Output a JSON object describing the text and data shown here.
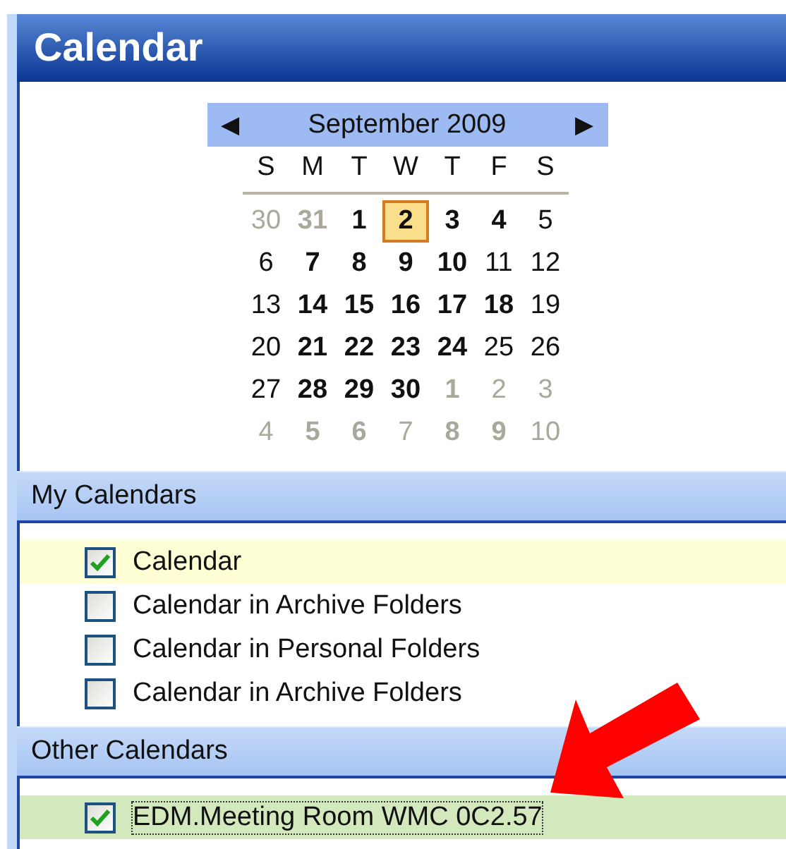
{
  "title": "Calendar",
  "month": {
    "prev": "◀",
    "label": "September 2009",
    "next": "▶",
    "weekdays": [
      "S",
      "M",
      "T",
      "W",
      "T",
      "F",
      "S"
    ],
    "weeks": [
      [
        {
          "day": "30",
          "bold": false,
          "other": true,
          "selected": false
        },
        {
          "day": "31",
          "bold": true,
          "other": true,
          "selected": false
        },
        {
          "day": "1",
          "bold": true,
          "other": false,
          "selected": false
        },
        {
          "day": "2",
          "bold": true,
          "other": false,
          "selected": true
        },
        {
          "day": "3",
          "bold": true,
          "other": false,
          "selected": false
        },
        {
          "day": "4",
          "bold": true,
          "other": false,
          "selected": false
        },
        {
          "day": "5",
          "bold": false,
          "other": false,
          "selected": false
        }
      ],
      [
        {
          "day": "6",
          "bold": false,
          "other": false,
          "selected": false
        },
        {
          "day": "7",
          "bold": true,
          "other": false,
          "selected": false
        },
        {
          "day": "8",
          "bold": true,
          "other": false,
          "selected": false
        },
        {
          "day": "9",
          "bold": true,
          "other": false,
          "selected": false
        },
        {
          "day": "10",
          "bold": true,
          "other": false,
          "selected": false
        },
        {
          "day": "11",
          "bold": false,
          "other": false,
          "selected": false
        },
        {
          "day": "12",
          "bold": false,
          "other": false,
          "selected": false
        }
      ],
      [
        {
          "day": "13",
          "bold": false,
          "other": false,
          "selected": false
        },
        {
          "day": "14",
          "bold": true,
          "other": false,
          "selected": false
        },
        {
          "day": "15",
          "bold": true,
          "other": false,
          "selected": false
        },
        {
          "day": "16",
          "bold": true,
          "other": false,
          "selected": false
        },
        {
          "day": "17",
          "bold": true,
          "other": false,
          "selected": false
        },
        {
          "day": "18",
          "bold": true,
          "other": false,
          "selected": false
        },
        {
          "day": "19",
          "bold": false,
          "other": false,
          "selected": false
        }
      ],
      [
        {
          "day": "20",
          "bold": false,
          "other": false,
          "selected": false
        },
        {
          "day": "21",
          "bold": true,
          "other": false,
          "selected": false
        },
        {
          "day": "22",
          "bold": true,
          "other": false,
          "selected": false
        },
        {
          "day": "23",
          "bold": true,
          "other": false,
          "selected": false
        },
        {
          "day": "24",
          "bold": true,
          "other": false,
          "selected": false
        },
        {
          "day": "25",
          "bold": false,
          "other": false,
          "selected": false
        },
        {
          "day": "26",
          "bold": false,
          "other": false,
          "selected": false
        }
      ],
      [
        {
          "day": "27",
          "bold": false,
          "other": false,
          "selected": false
        },
        {
          "day": "28",
          "bold": true,
          "other": false,
          "selected": false
        },
        {
          "day": "29",
          "bold": true,
          "other": false,
          "selected": false
        },
        {
          "day": "30",
          "bold": true,
          "other": false,
          "selected": false
        },
        {
          "day": "1",
          "bold": true,
          "other": true,
          "selected": false
        },
        {
          "day": "2",
          "bold": false,
          "other": true,
          "selected": false
        },
        {
          "day": "3",
          "bold": false,
          "other": true,
          "selected": false
        }
      ],
      [
        {
          "day": "4",
          "bold": false,
          "other": true,
          "selected": false
        },
        {
          "day": "5",
          "bold": true,
          "other": true,
          "selected": false
        },
        {
          "day": "6",
          "bold": true,
          "other": true,
          "selected": false
        },
        {
          "day": "7",
          "bold": false,
          "other": true,
          "selected": false
        },
        {
          "day": "8",
          "bold": true,
          "other": true,
          "selected": false
        },
        {
          "day": "9",
          "bold": true,
          "other": true,
          "selected": false
        },
        {
          "day": "10",
          "bold": false,
          "other": true,
          "selected": false
        }
      ]
    ]
  },
  "groups": [
    {
      "title": "My Calendars",
      "items": [
        {
          "label": "Calendar",
          "checked": true,
          "selected": true,
          "color": "#ffffd5"
        },
        {
          "label": "Calendar in Archive Folders",
          "checked": false,
          "selected": false
        },
        {
          "label": "Calendar in Personal Folders",
          "checked": false,
          "selected": false
        },
        {
          "label": "Calendar in Archive Folders",
          "checked": false,
          "selected": false
        }
      ]
    },
    {
      "title": "Other Calendars",
      "items": [
        {
          "label": "EDM.Meeting Room WMC 0C2.57",
          "checked": true,
          "selected": true,
          "color": "#d3e8bd"
        }
      ]
    }
  ]
}
